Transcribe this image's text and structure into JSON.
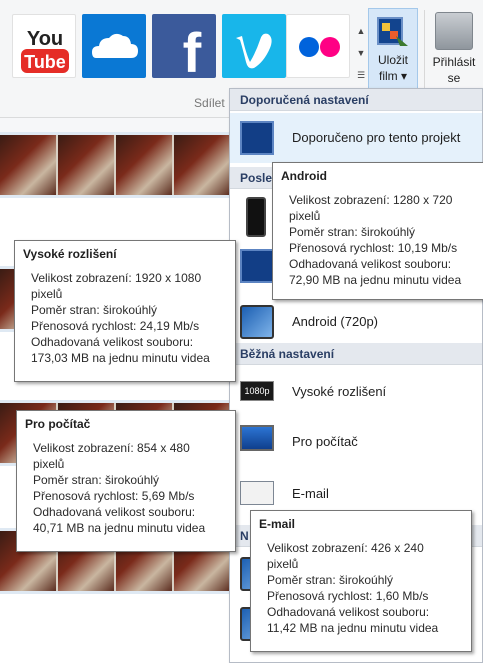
{
  "ribbon": {
    "services": [
      {
        "name": "YouTube",
        "text": "You Tube"
      },
      {
        "name": "OneDrive"
      },
      {
        "name": "Facebook",
        "text": "f"
      },
      {
        "name": "Vimeo",
        "text": "v"
      },
      {
        "name": "Flickr"
      }
    ],
    "group_label": "Sdílet",
    "save_button": {
      "line1": "Uložit",
      "line2": "film ▾"
    },
    "share_button": {
      "line1": "Přihlásit",
      "line2": "se"
    }
  },
  "menu": {
    "heading_recommended": "Doporučená nastavení",
    "item_recommended": "Doporučeno pro tento projekt",
    "heading_last_partial": "Posle",
    "item_android": "Android (720p)",
    "heading_common": "Běžná nastavení",
    "item_high": "Vysoké rozlišení",
    "item_pc": "Pro počítač",
    "item_email": "E-mail",
    "heading_bottom_partial": "N",
    "hd_badge": "1080p"
  },
  "tooltips": {
    "android": {
      "title": "Android",
      "lines": [
        "Velikost zobrazení: 1280 x 720",
        "pixelů",
        "Poměr stran: širokoúhlý",
        "Přenosová rychlost: 10,19 Mb/s",
        "Odhadovaná velikost souboru:",
        "72,90 MB na jednu minutu videa"
      ]
    },
    "high": {
      "title": "Vysoké rozlišení",
      "lines": [
        "Velikost zobrazení: 1920 x 1080",
        "pixelů",
        "Poměr stran: širokoúhlý",
        "Přenosová rychlost: 24,19 Mb/s",
        "Odhadovaná velikost souboru:",
        "173,03 MB na jednu minutu videa"
      ]
    },
    "pc": {
      "title": "Pro počítač",
      "lines": [
        "Velikost zobrazení: 854 x 480",
        "pixelů",
        "Poměr stran: širokoúhlý",
        "Přenosová rychlost: 5,69 Mb/s",
        "Odhadovaná velikost souboru:",
        "40,71 MB na jednu minutu videa"
      ]
    },
    "email": {
      "title": "E-mail",
      "lines": [
        "Velikost zobrazení: 426 x 240",
        "pixelů",
        "Poměr stran: širokoúhlý",
        "Přenosová rychlost: 1,60 Mb/s",
        "Odhadovaná velikost souboru:",
        "11,42 MB na jednu minutu videa"
      ]
    }
  },
  "colors": {
    "menu_heading_bg": "#e4e8ee",
    "menu_heading_text": "#2a3e64",
    "hover_bg": "#e5f1fb",
    "youtube_red": "#e52d27",
    "facebook_blue": "#3b5a9b",
    "vimeo_blue": "#18b6ea",
    "onedrive_blue": "#0a78d4"
  }
}
